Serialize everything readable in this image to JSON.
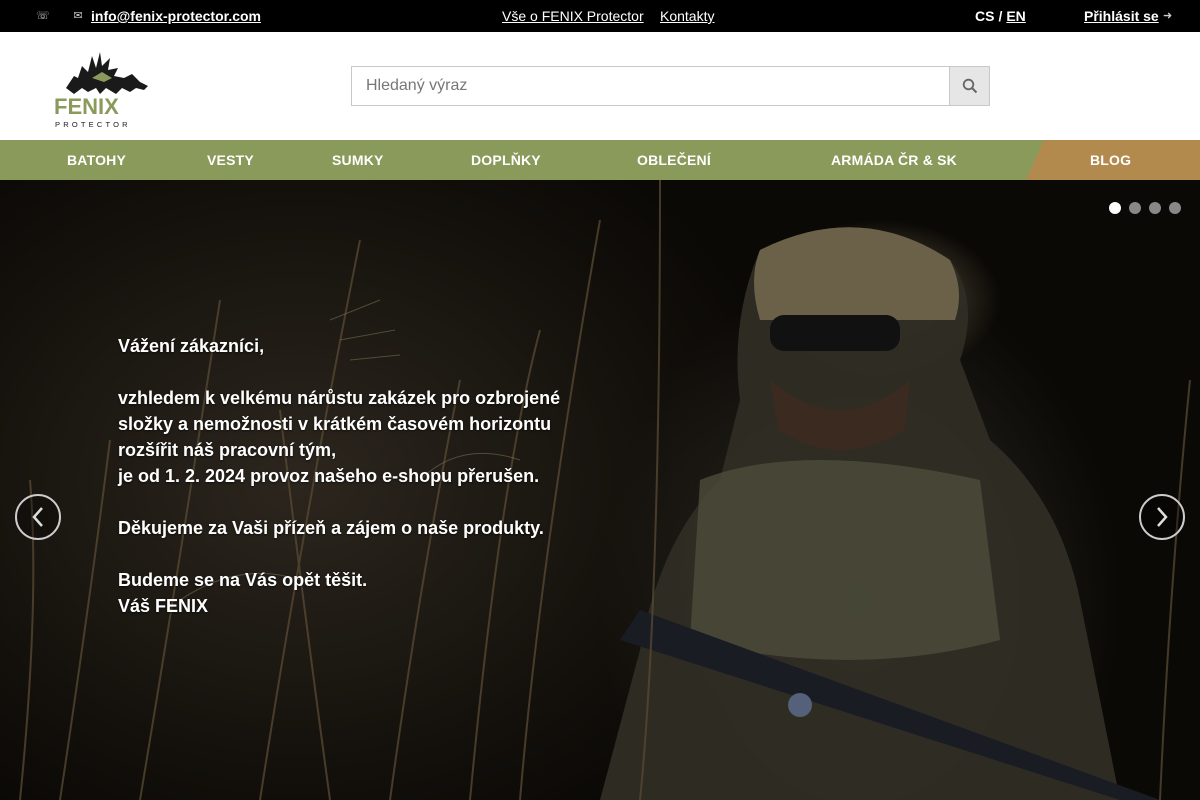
{
  "topbar": {
    "phone_icon": "phone-icon",
    "mail_icon": "envelope-icon",
    "email": "info@fenix-protector.com",
    "about_link": "Vše o FENIX Protector",
    "contacts_link": "Kontakty",
    "lang_cs": "CS",
    "lang_sep": "/",
    "lang_en": "EN",
    "login": "Přihlásit se",
    "login_icon": "sign-in-icon"
  },
  "header": {
    "logo_brand": "FENIX",
    "logo_sub": "PROTECTOR",
    "search_placeholder": "Hledaný výraz",
    "search_icon": "search-icon"
  },
  "nav": {
    "items": [
      {
        "label": "BATOHY"
      },
      {
        "label": "VESTY"
      },
      {
        "label": "SUMKY"
      },
      {
        "label": "DOPLŇKY"
      },
      {
        "label": "OBLEČENÍ"
      },
      {
        "label": "ARMÁDA ČR & SK"
      },
      {
        "label": "BLOG"
      }
    ],
    "colors": {
      "nav_bg": "#8a9a5b",
      "blog_bg": "#b38a4e"
    }
  },
  "hero": {
    "lines": [
      "Vážení zákazníci,",
      "",
      "vzhledem k velkému nárůstu zakázek pro ozbrojené",
      "složky a nemožnosti v krátkém časovém horizontu",
      "rozšířit náš pracovní tým,",
      "je od 1. 2. 2024 provoz našeho e-shopu přerušen.",
      "",
      "Děkujeme za Vaši přízeň a zájem o naše produkty.",
      "",
      "Budeme se na Vás opět těšit.",
      "Váš FENIX"
    ],
    "prev_icon": "chevron-left-icon",
    "next_icon": "chevron-right-icon",
    "slides_count": 4,
    "active_slide": 1
  }
}
